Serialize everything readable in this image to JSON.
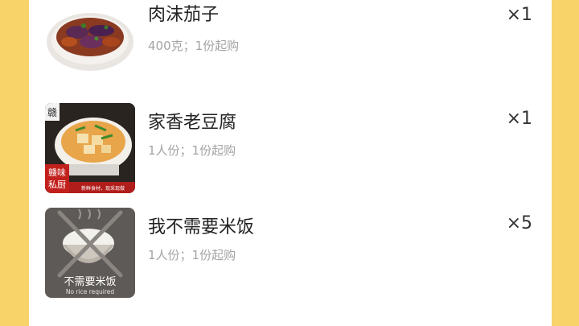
{
  "order_items": [
    {
      "name": "肉沫茄子",
      "portion": "400克；1份起购",
      "quantity": "×1",
      "image": "braised-eggplant-photo"
    },
    {
      "name": "家香老豆腐",
      "portion": "1人份；1份起购",
      "quantity": "×1",
      "image": "tofu-dish-photo",
      "image_text": [
        "赣味",
        "私厨",
        "赣",
        "新鲜食材，现采现做"
      ]
    },
    {
      "name": "我不需要米饭",
      "portion": "1人份；1份起购",
      "quantity": "×5",
      "image": "no-rice-icon",
      "image_text": [
        "不需要米饭",
        "No rice required"
      ]
    }
  ],
  "colors": {
    "background": "#f7d36a",
    "card": "#ffffff",
    "name_text": "#222222",
    "meta_text": "#a3a3a3"
  }
}
